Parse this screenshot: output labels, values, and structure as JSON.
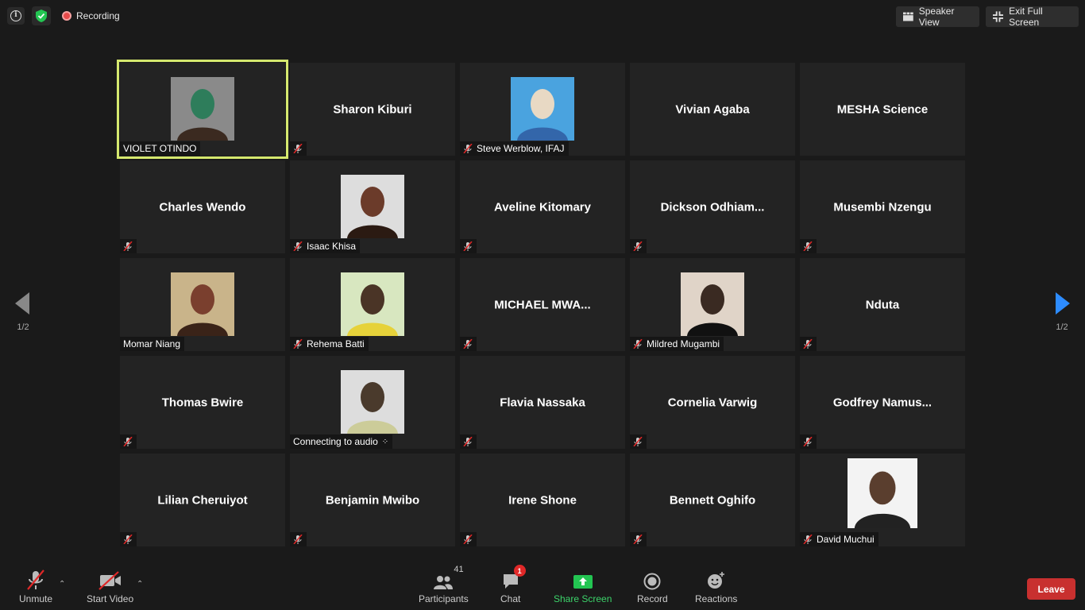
{
  "topbar": {
    "recording_label": "Recording",
    "speaker_view_label": "Speaker View",
    "exit_fullscreen_label": "Exit Full Screen"
  },
  "pagination": {
    "left": "1/2",
    "right": "1/2"
  },
  "participants": [
    {
      "name": "VIOLET OTINDO",
      "video": true,
      "muted": false,
      "active": true
    },
    {
      "name": "Sharon Kiburi",
      "video": false,
      "muted": true
    },
    {
      "name": "Steve Werblow, IFAJ",
      "video": true,
      "muted": true
    },
    {
      "name": "Vivian Agaba",
      "video": false,
      "muted": false
    },
    {
      "name": "MESHA Science",
      "video": false,
      "muted": false
    },
    {
      "name": "Charles Wendo",
      "video": false,
      "muted": true
    },
    {
      "name": "Isaac Khisa",
      "video": true,
      "muted": true
    },
    {
      "name": "Aveline Kitomary",
      "video": false,
      "muted": true
    },
    {
      "name": "Dickson  Odhiam...",
      "video": false,
      "muted": true
    },
    {
      "name": "Musembi Nzengu",
      "video": false,
      "muted": true
    },
    {
      "name": "Momar Niang",
      "video": true,
      "muted": false
    },
    {
      "name": "Rehema Batti",
      "video": true,
      "muted": true
    },
    {
      "name": "MICHAEL  MWA...",
      "video": false,
      "muted": true
    },
    {
      "name": "Mildred Mugambi",
      "video": true,
      "muted": true
    },
    {
      "name": "Nduta",
      "video": false,
      "muted": true
    },
    {
      "name": "Thomas Bwire",
      "video": false,
      "muted": true
    },
    {
      "name": "Connecting to audio",
      "video": true,
      "muted": false,
      "connecting": true
    },
    {
      "name": "Flavia Nassaka",
      "video": false,
      "muted": true
    },
    {
      "name": "Cornelia Varwig",
      "video": false,
      "muted": true
    },
    {
      "name": "Godfrey  Namus...",
      "video": false,
      "muted": true
    },
    {
      "name": "Lilian Cheruiyot",
      "video": false,
      "muted": true
    },
    {
      "name": "Benjamin Mwibo",
      "video": false,
      "muted": true
    },
    {
      "name": "Irene Shone",
      "video": false,
      "muted": true
    },
    {
      "name": "Bennett Oghifo",
      "video": false,
      "muted": true
    },
    {
      "name": "David Muchui",
      "video": true,
      "muted": true
    }
  ],
  "toolbar": {
    "unmute_label": "Unmute",
    "start_video_label": "Start Video",
    "participants_label": "Participants",
    "participants_count": "41",
    "chat_label": "Chat",
    "chat_badge": "1",
    "share_label": "Share Screen",
    "record_label": "Record",
    "reactions_label": "Reactions",
    "leave_label": "Leave"
  },
  "colors": {
    "active_speaker": "#d5e86e",
    "share_green": "#3cd36a",
    "leave_red": "#c8302f"
  }
}
